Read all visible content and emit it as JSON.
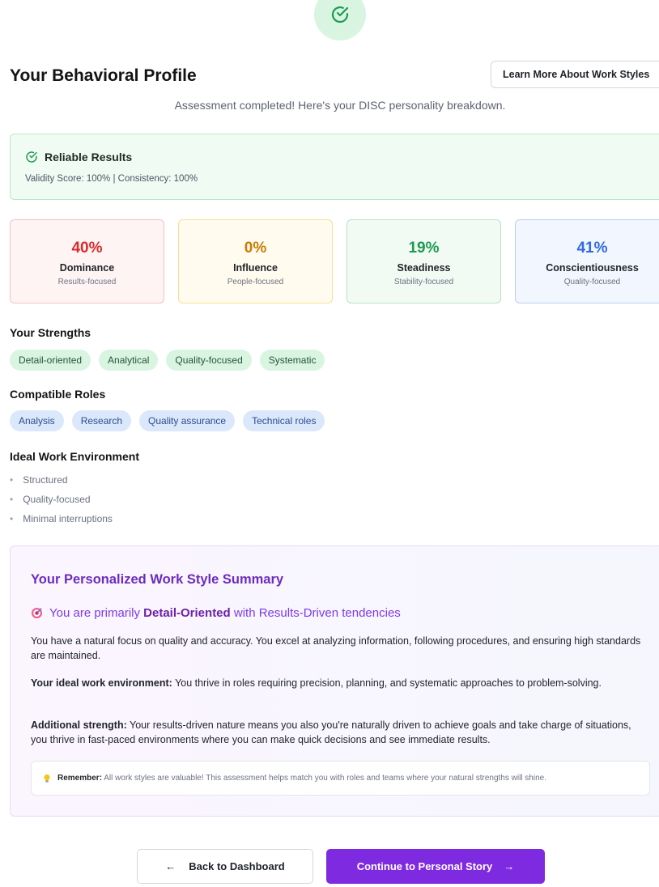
{
  "header": {
    "title": "Your Behavioral Profile",
    "learn_more": "Learn More About Work Styles",
    "subtitle": "Assessment completed! Here's your DISC personality breakdown."
  },
  "reliability": {
    "title": "Reliable Results",
    "detail": "Validity Score: 100% | Consistency: 100%"
  },
  "disc": [
    {
      "percent": "40%",
      "name": "Dominance",
      "desc": "Results-focused",
      "color": "#d92b2b"
    },
    {
      "percent": "0%",
      "name": "Influence",
      "desc": "People-focused",
      "color": "#c97c05"
    },
    {
      "percent": "19%",
      "name": "Steadiness",
      "desc": "Stability-focused",
      "color": "#1e9a4f"
    },
    {
      "percent": "41%",
      "name": "Conscientiousness",
      "desc": "Quality-focused",
      "color": "#2f6ae0"
    }
  ],
  "strengths": {
    "title": "Your Strengths",
    "items": [
      "Detail-oriented",
      "Analytical",
      "Quality-focused",
      "Systematic"
    ]
  },
  "roles": {
    "title": "Compatible Roles",
    "items": [
      "Analysis",
      "Research",
      "Quality assurance",
      "Technical roles"
    ]
  },
  "environment": {
    "title": "Ideal Work Environment",
    "items": [
      "Structured",
      "Quality-focused",
      "Minimal interruptions"
    ]
  },
  "summary": {
    "title": "Your Personalized Work Style Summary",
    "primary_prefix": "You are primarily",
    "primary_style": "Detail-Oriented",
    "primary_suffix": "with Results-Driven tendencies",
    "intro": "You have a natural focus on quality and accuracy. You excel at analyzing information, following procedures, and ensuring high standards are maintained.",
    "env_label": "Your ideal work environment:",
    "env_text": "You thrive in roles requiring precision, planning, and systematic approaches to problem-solving.",
    "add_label": "Additional strength:",
    "add_text": "Your results-driven nature means you also you're naturally driven to achieve goals and take charge of situations, you thrive in fast-paced environments where you can make quick decisions and see immediate results.",
    "remember_label": "Remember:",
    "remember_text": "All work styles are valuable! This assessment helps match you with roles and teams where your natural strengths will shine."
  },
  "actions": {
    "back": "Back to Dashboard",
    "continue": "Continue to Personal Story"
  },
  "icons": {
    "top": "check-circle-icon",
    "reliable": "check-circle-icon",
    "target": "target-icon",
    "bulb": "lightbulb-icon",
    "back": "arrow-left-icon",
    "forward": "arrow-right-icon"
  }
}
